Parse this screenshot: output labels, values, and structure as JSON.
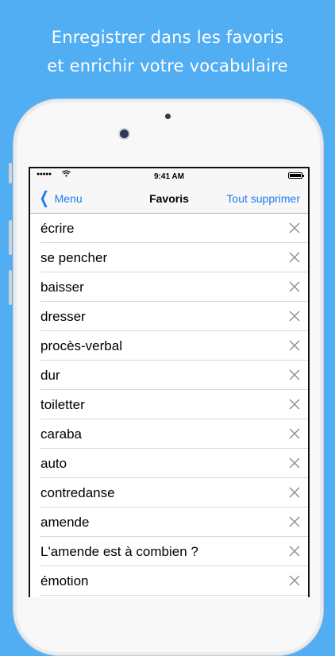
{
  "headline": {
    "line1": "Enregistrer dans les favoris",
    "line2": "et enrichir votre vocabulaire"
  },
  "status_bar": {
    "signal": "●●●●●",
    "time": "9:41 AM"
  },
  "nav": {
    "back_label": "Menu",
    "title": "Favoris",
    "action_label": "Tout supprimer"
  },
  "favorites": [
    "écrire",
    "se pencher",
    "baisser",
    "dresser",
    "procès-verbal",
    "dur",
    "toiletter",
    "caraba",
    "auto",
    "contredanse",
    "amende",
    "L'amende est à combien ?",
    "émotion"
  ],
  "colors": {
    "background": "#52aef2",
    "accent": "#1d7bf5",
    "delete_icon": "#8e8e93"
  }
}
